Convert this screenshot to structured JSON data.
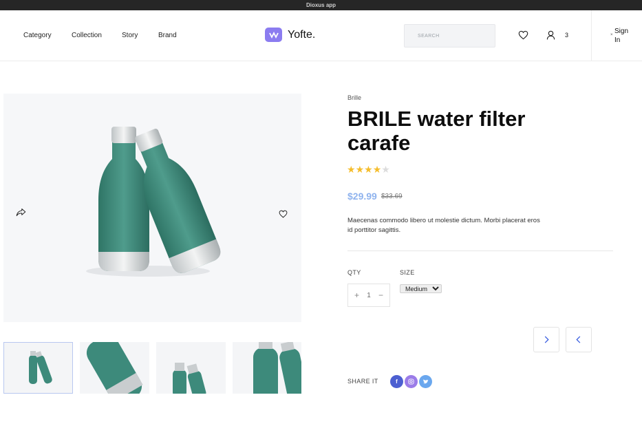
{
  "window": {
    "title": "Dioxus app"
  },
  "nav": {
    "items": [
      "Category",
      "Collection",
      "Story",
      "Brand"
    ]
  },
  "logo": {
    "text": "Yofte."
  },
  "search": {
    "placeholder": "SEARCH"
  },
  "cart": {
    "count": "3"
  },
  "auth": {
    "signin_label": "Sign In",
    "close_glyph": "×"
  },
  "product": {
    "brand": "Brille",
    "title": "BRILE water filter carafe",
    "rating": {
      "value": 4,
      "max": 5
    },
    "price": "$29.99",
    "old_price": "$33.69",
    "description": "Maecenas commodo libero ut molestie dictum. Morbi placerat eros id porttitor sagittis."
  },
  "options": {
    "qty_label": "QTY",
    "qty_value": "1",
    "size_label": "SIZE",
    "size_selected": "Medium"
  },
  "share": {
    "label": "SHARE IT"
  },
  "colors": {
    "accent": "#8b7cf0",
    "price": "#8fb3ee",
    "arrow": "#3b5fe0",
    "bottle": "#3d8a7b"
  },
  "icons": [
    "heart-icon",
    "user-icon",
    "share-icon",
    "chevron-right-icon",
    "chevron-left-icon",
    "facebook-icon",
    "instagram-icon",
    "twitter-icon"
  ]
}
